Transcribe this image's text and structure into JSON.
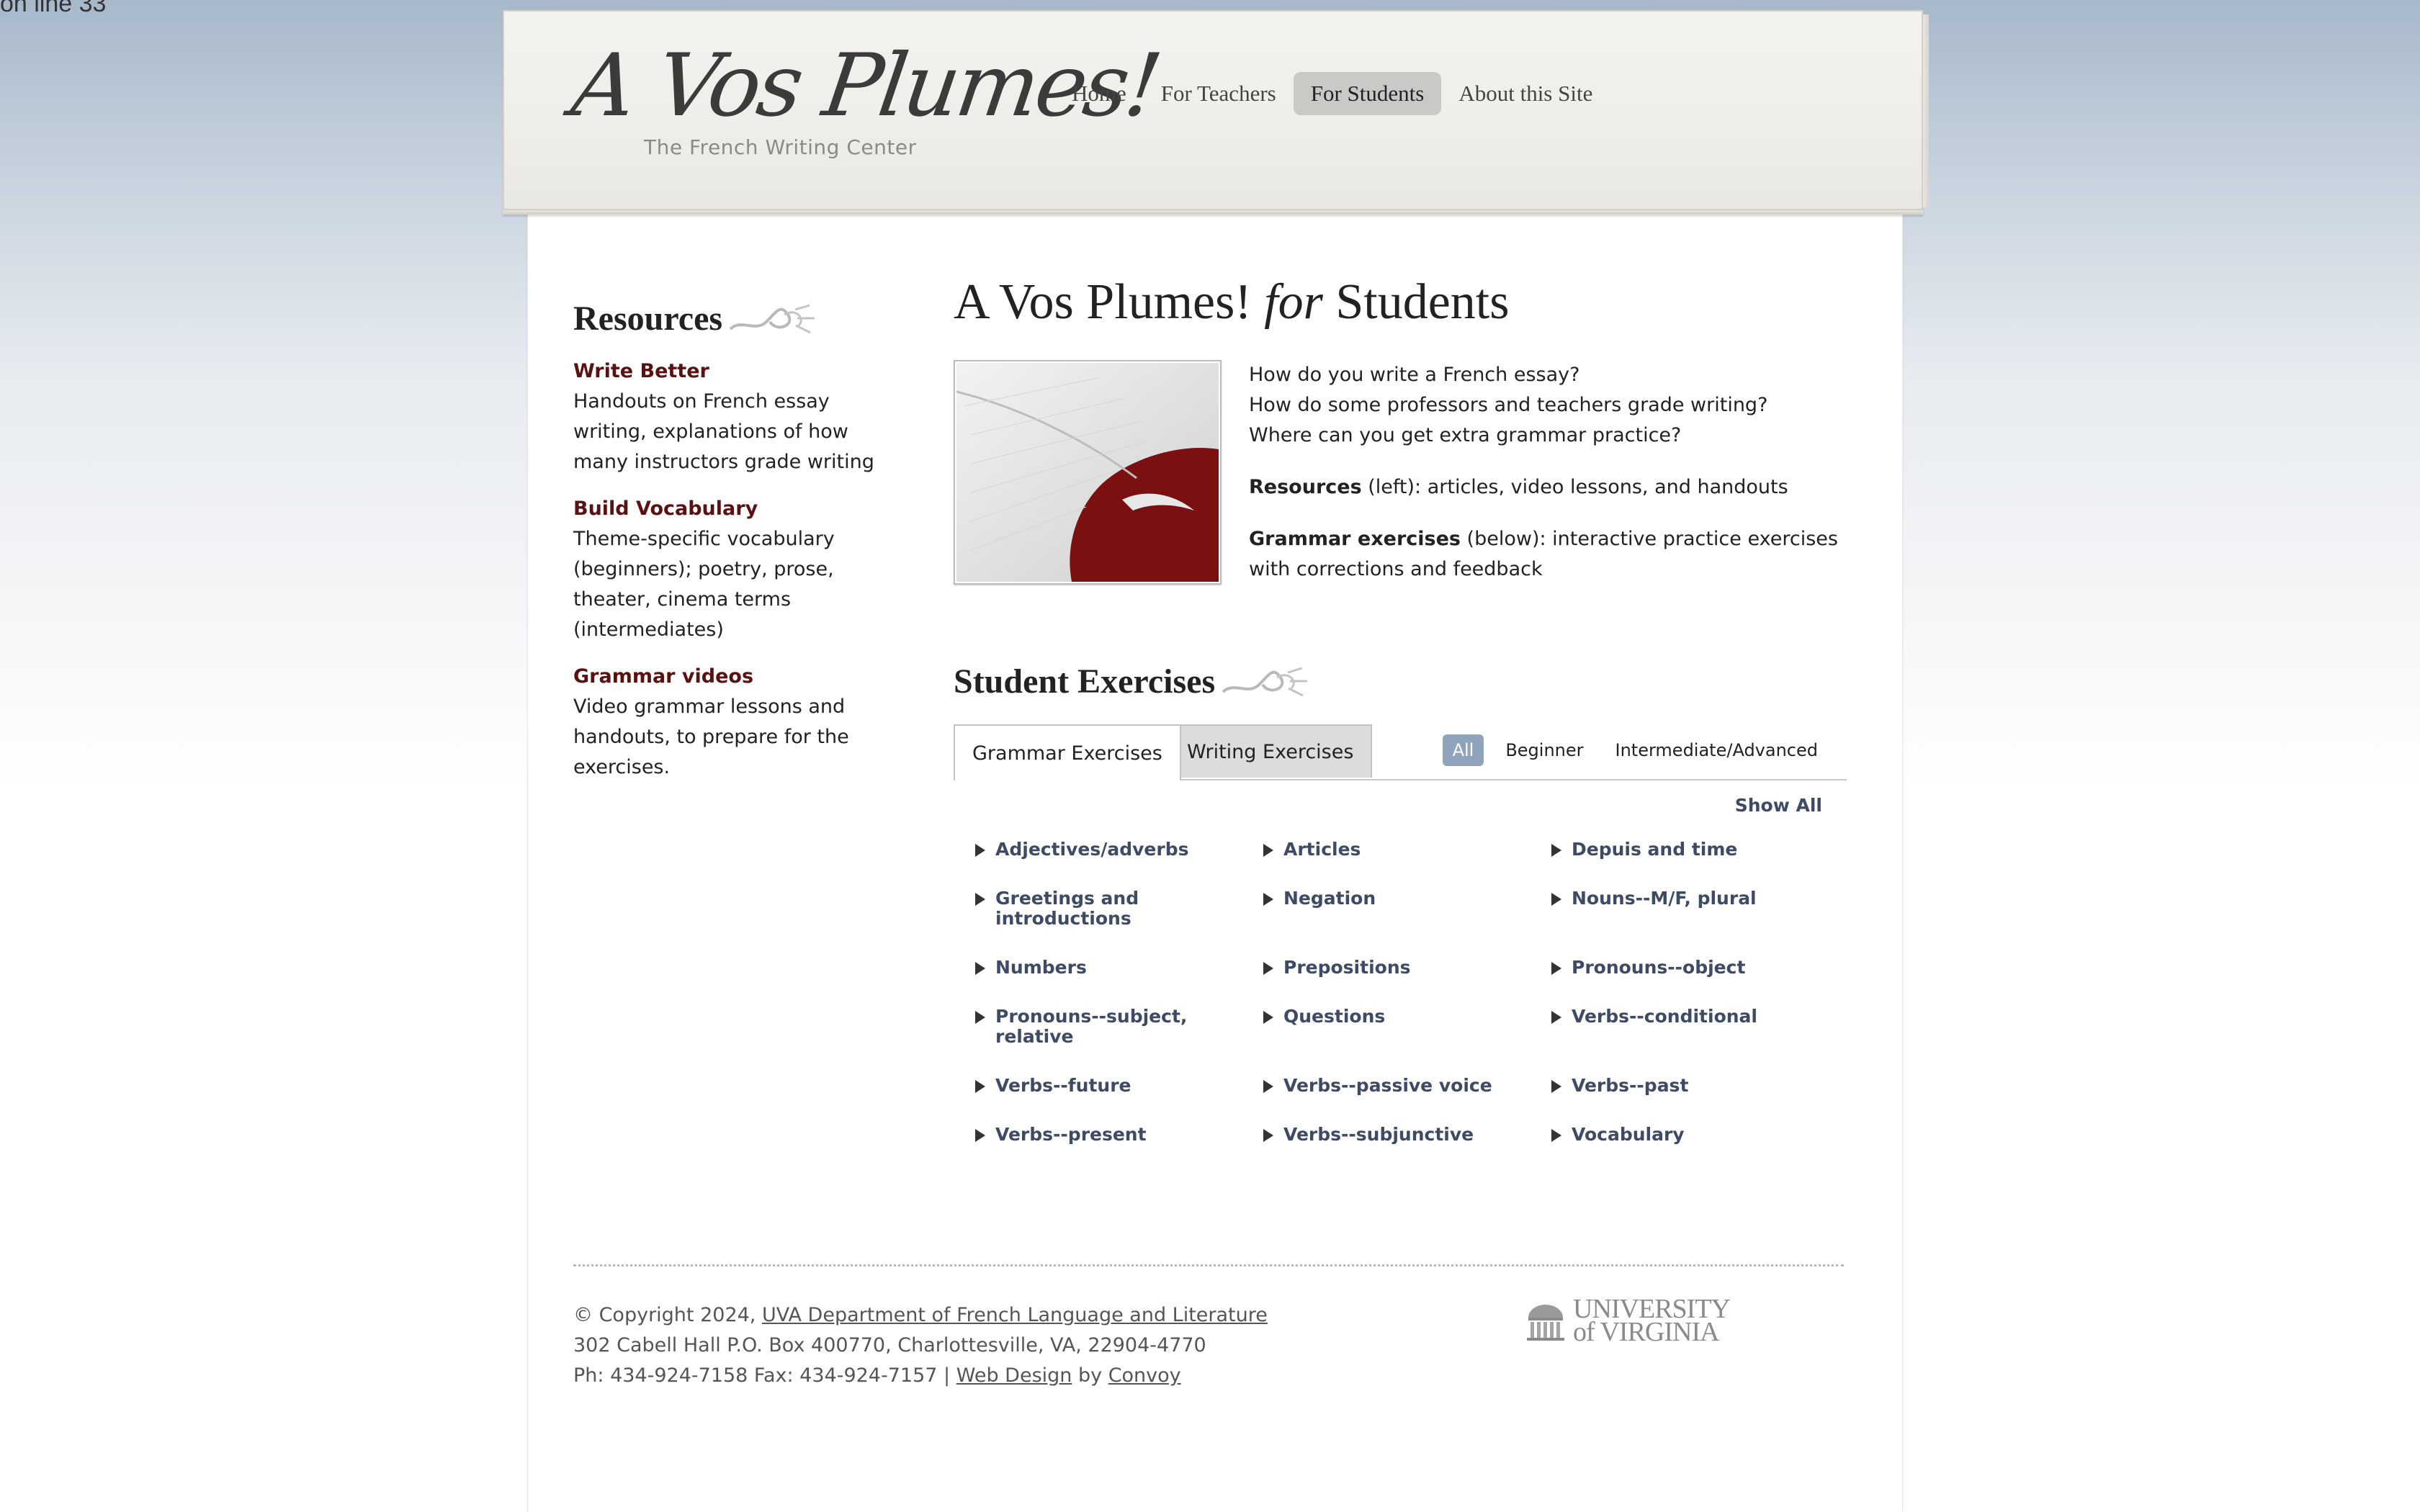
{
  "corner_text": "on line 33",
  "header": {
    "logo": "A Vos Plumes!",
    "tagline": "The French Writing Center",
    "nav": [
      {
        "label": "Home",
        "active": false
      },
      {
        "label": "For Teachers",
        "active": false
      },
      {
        "label": "For Students",
        "active": true
      },
      {
        "label": "About this Site",
        "active": false
      }
    ]
  },
  "sidebar": {
    "title": "Resources",
    "items": [
      {
        "label": "Write Better",
        "desc": "Handouts on French essay writing, explanations of how many instructors grade writing"
      },
      {
        "label": "Build Vocabulary",
        "desc": "Theme-specific vocabulary (beginners); poetry, prose, theater, cinema terms (intermediates)"
      },
      {
        "label": "Grammar videos",
        "desc": "Video grammar lessons and handouts, to prepare for the exercises."
      }
    ]
  },
  "main": {
    "title_pre": "A Vos Plumes!",
    "title_for": "for",
    "title_post": "Students",
    "questions": [
      "How do you write a French essay?",
      "How do some professors and teachers grade writing?",
      "Where can you get extra grammar practice?"
    ],
    "resources_bold": "Resources",
    "resources_rest": " (left): articles, video lessons, and handouts",
    "grammar_bold": "Grammar exercises",
    "grammar_rest": " (below): interactive practice exercises with corrections and feedback",
    "exercises_title": "Student Exercises",
    "tabs": [
      "Grammar Exercises",
      "Writing Exercises"
    ],
    "filters": [
      "All",
      "Beginner",
      "Intermediate/Advanced"
    ],
    "show_all": "Show All",
    "topics": [
      "Adjectives/adverbs",
      "Articles",
      "Depuis and time",
      "Greetings and introductions",
      "Negation",
      "Nouns--M/F, plural",
      "Numbers",
      "Prepositions",
      "Pronouns--object",
      "Pronouns--subject, relative",
      "Questions",
      "Verbs--conditional",
      "Verbs--future",
      "Verbs--passive voice",
      "Verbs--past",
      "Verbs--present",
      "Verbs--subjunctive",
      "Vocabulary"
    ]
  },
  "footer": {
    "copyright": "© Copyright 2024, ",
    "dept_link": "UVA Department of French Language and Literature",
    "address": "302 Cabell Hall P.O. Box 400770, Charlottesville, VA, 22904-4770",
    "phone": "Ph: 434-924-7158 Fax: 434-924-7157 | ",
    "web_design": "Web Design",
    "by": " by ",
    "convoy": "Convoy",
    "uva_line1": "UNIVERSITY",
    "uva_line2": "of VIRGINIA"
  },
  "colors": {
    "link_dark_red": "#5a1111",
    "topic_blue": "#3d4b66",
    "filter_active": "#8fa3bd",
    "nav_active_bg": "#c9c9c6"
  }
}
